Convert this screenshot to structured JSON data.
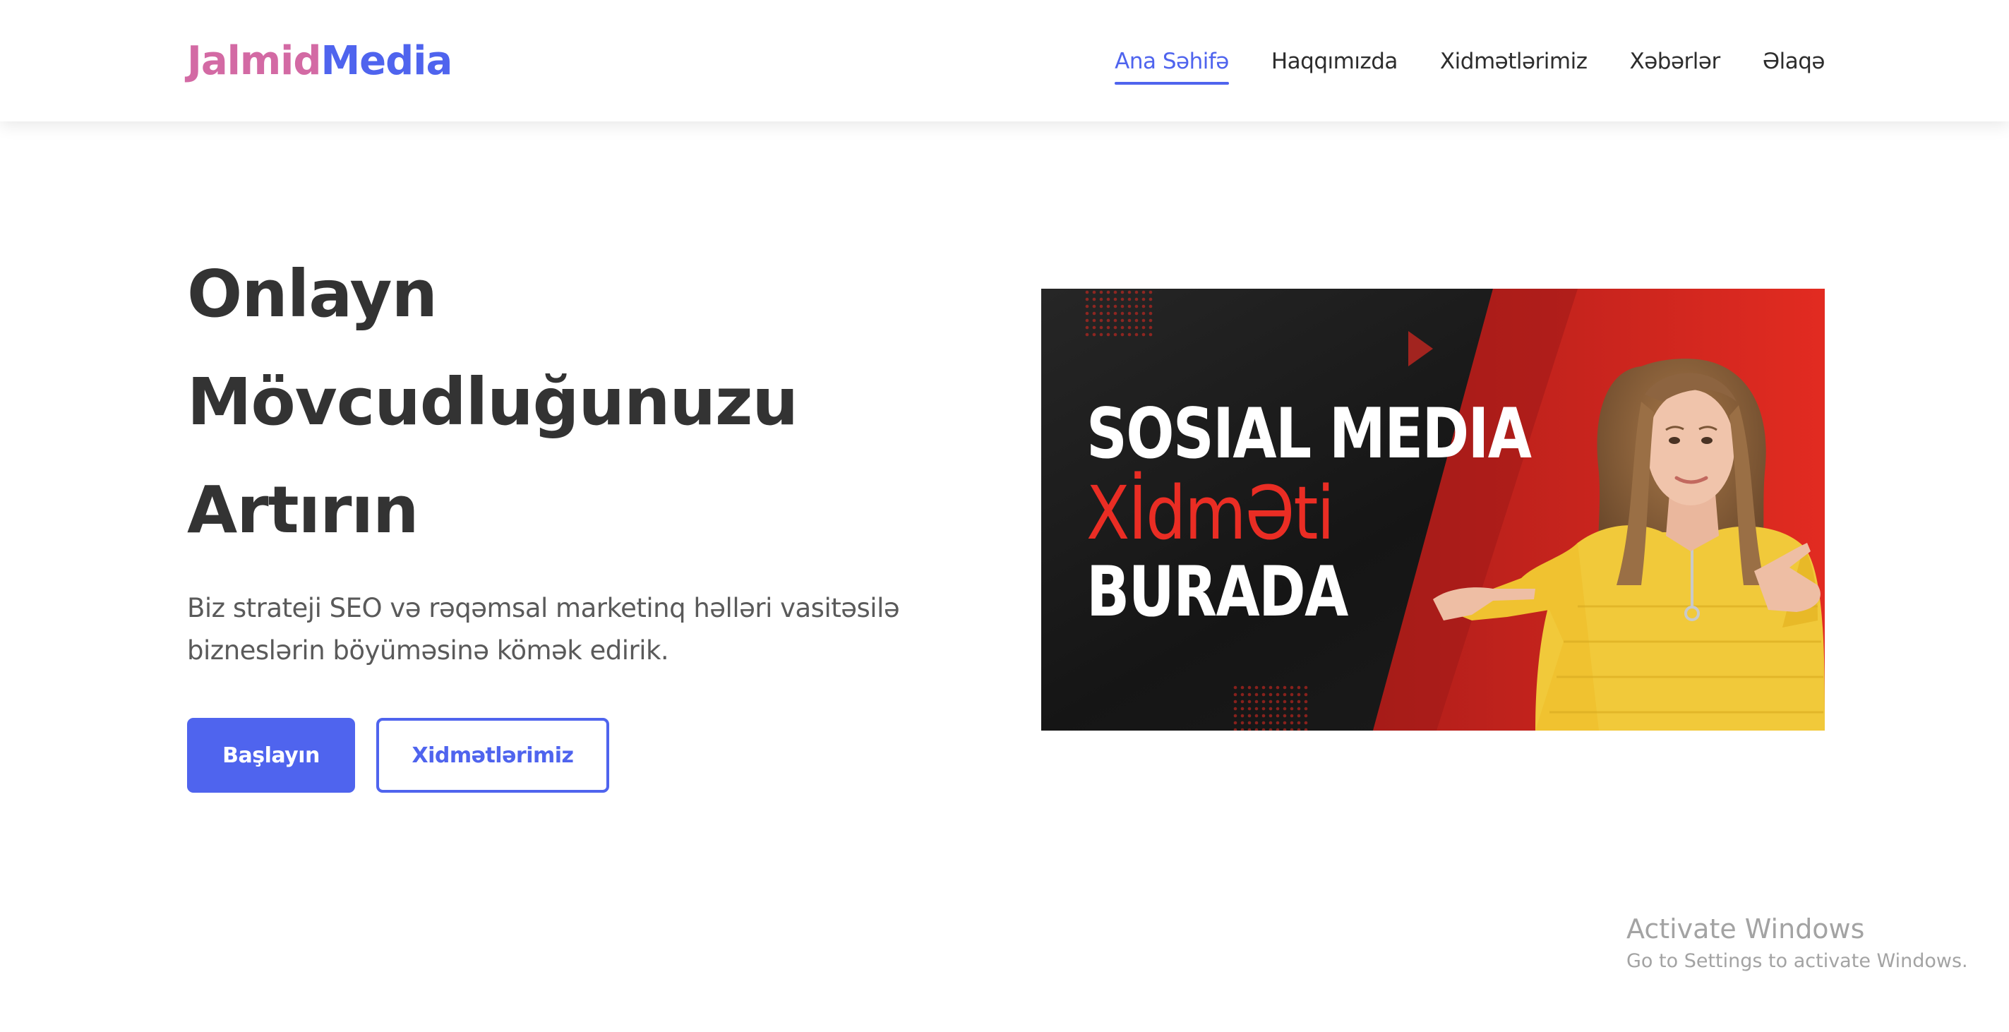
{
  "header": {
    "logo_part1": "Jalmid",
    "logo_part2": "Media",
    "nav": [
      {
        "label": "Ana Səhifə",
        "active": true
      },
      {
        "label": "Haqqımızda",
        "active": false
      },
      {
        "label": "Xidmətlərimiz",
        "active": false
      },
      {
        "label": "Xəbərlər",
        "active": false
      },
      {
        "label": "Əlaqə",
        "active": false
      }
    ]
  },
  "hero": {
    "title_lines": [
      "Onlayn",
      "Mövcudluğunuzu",
      "Artırın"
    ],
    "description_lines": [
      "Biz strateji SEO və rəqəmsal marketinq həlləri vasitəsilə",
      "bizneslərin böyüməsinə kömək edirik."
    ],
    "primary_button": "Başlayın",
    "secondary_button": "Xidmətlərimiz"
  },
  "banner": {
    "line1": "SOSIAL MEDIA",
    "line2": "XİdmƏti",
    "line3": "BURADA"
  },
  "watermark": {
    "title": "Activate Windows",
    "subtitle": "Go to Settings to activate Windows."
  },
  "colors": {
    "accent": "#4f64ee",
    "logo_pink": "#d36aa4",
    "banner_red": "#e1271f",
    "banner_dark": "#1b1b1b",
    "sweater_yellow": "#f1c93a"
  }
}
